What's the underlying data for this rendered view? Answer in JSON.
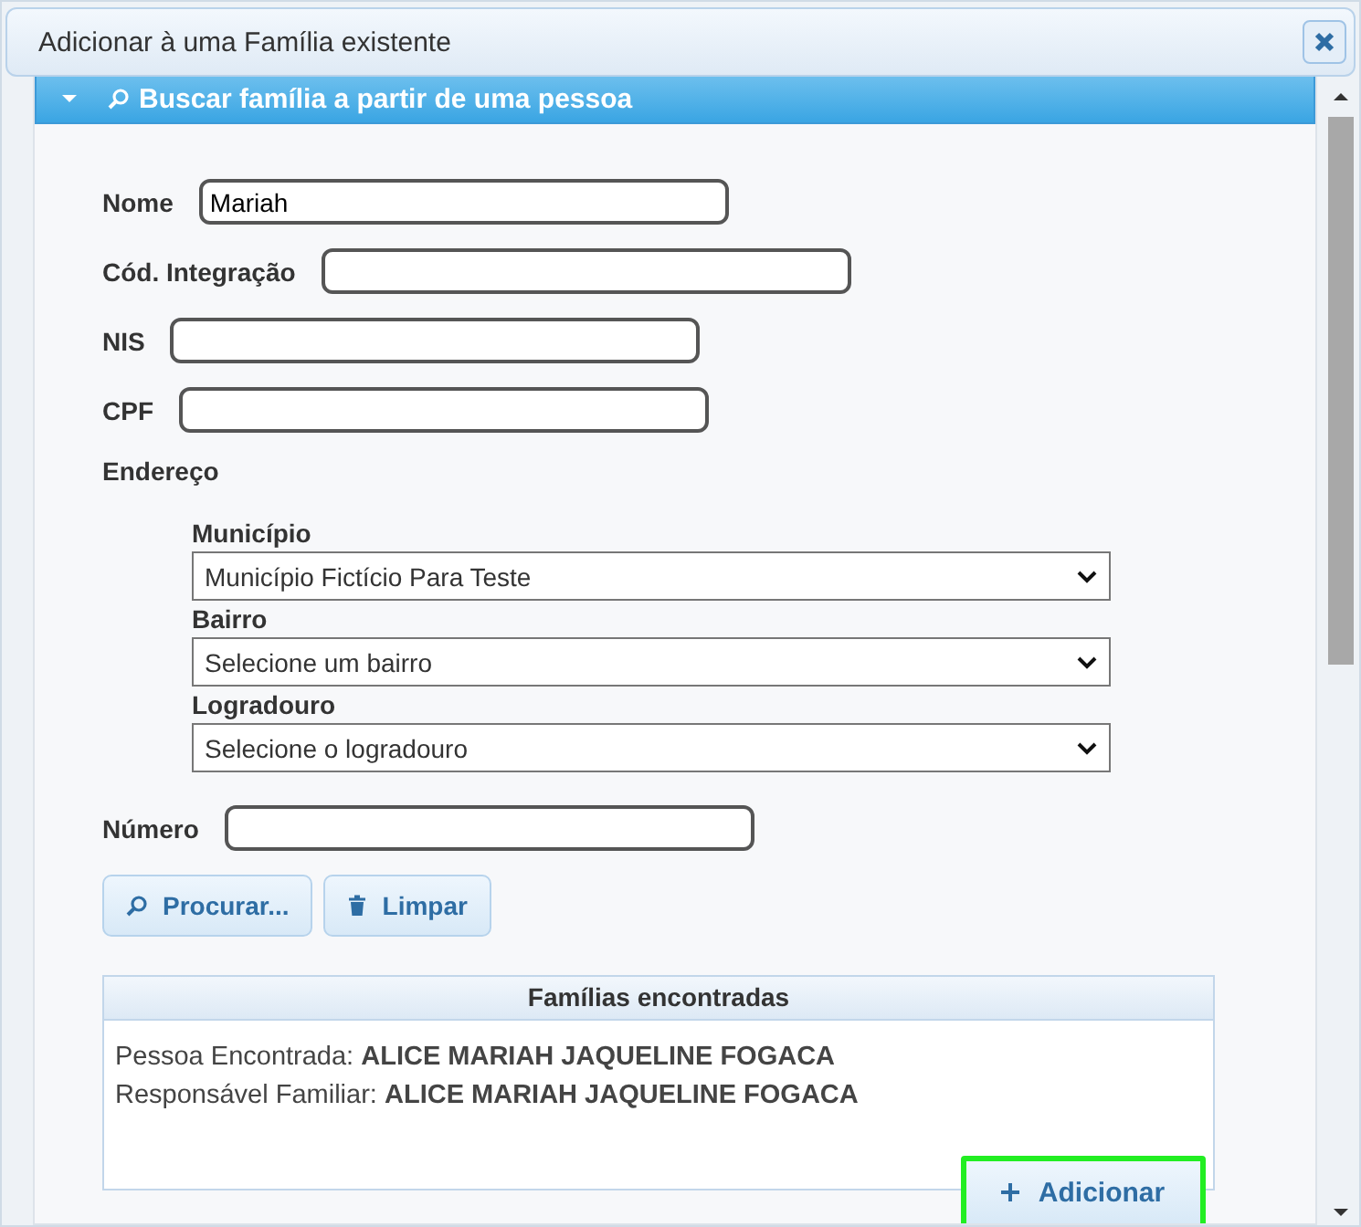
{
  "dialog": {
    "title": "Adicionar à uma Família existente"
  },
  "section": {
    "title": "Buscar família a partir de uma pessoa",
    "expanded": true
  },
  "fields": [
    {
      "label": "Nome",
      "value": "Mariah"
    },
    {
      "label": "Cód. Integração"
    },
    {
      "label": "NIS"
    },
    {
      "label": "CPF"
    }
  ],
  "address": {
    "label": "Endereço",
    "selects": [
      {
        "label": "Município",
        "value": "Município Fictício Para Teste"
      },
      {
        "label": "Bairro",
        "value": "Selecione um bairro"
      },
      {
        "label": "Logradouro",
        "value": "Selecione o logradouro"
      }
    ]
  },
  "number_field": {
    "label": "Número"
  },
  "buttons": [
    {
      "label": "Procurar...",
      "kind": "search"
    },
    {
      "label": "Limpar",
      "kind": "trash"
    }
  ],
  "results": {
    "title": "Famílias encontradas",
    "lines": [
      "Pessoa Encontrada: **ALICE MARIAH JAQUELINE FOGACA**",
      "Responsável Familiar: **ALICE MARIAH JAQUELINE FOGACA**"
    ],
    "add_button": {
      "label": "Adicionar",
      "highlighted": true
    }
  }
}
